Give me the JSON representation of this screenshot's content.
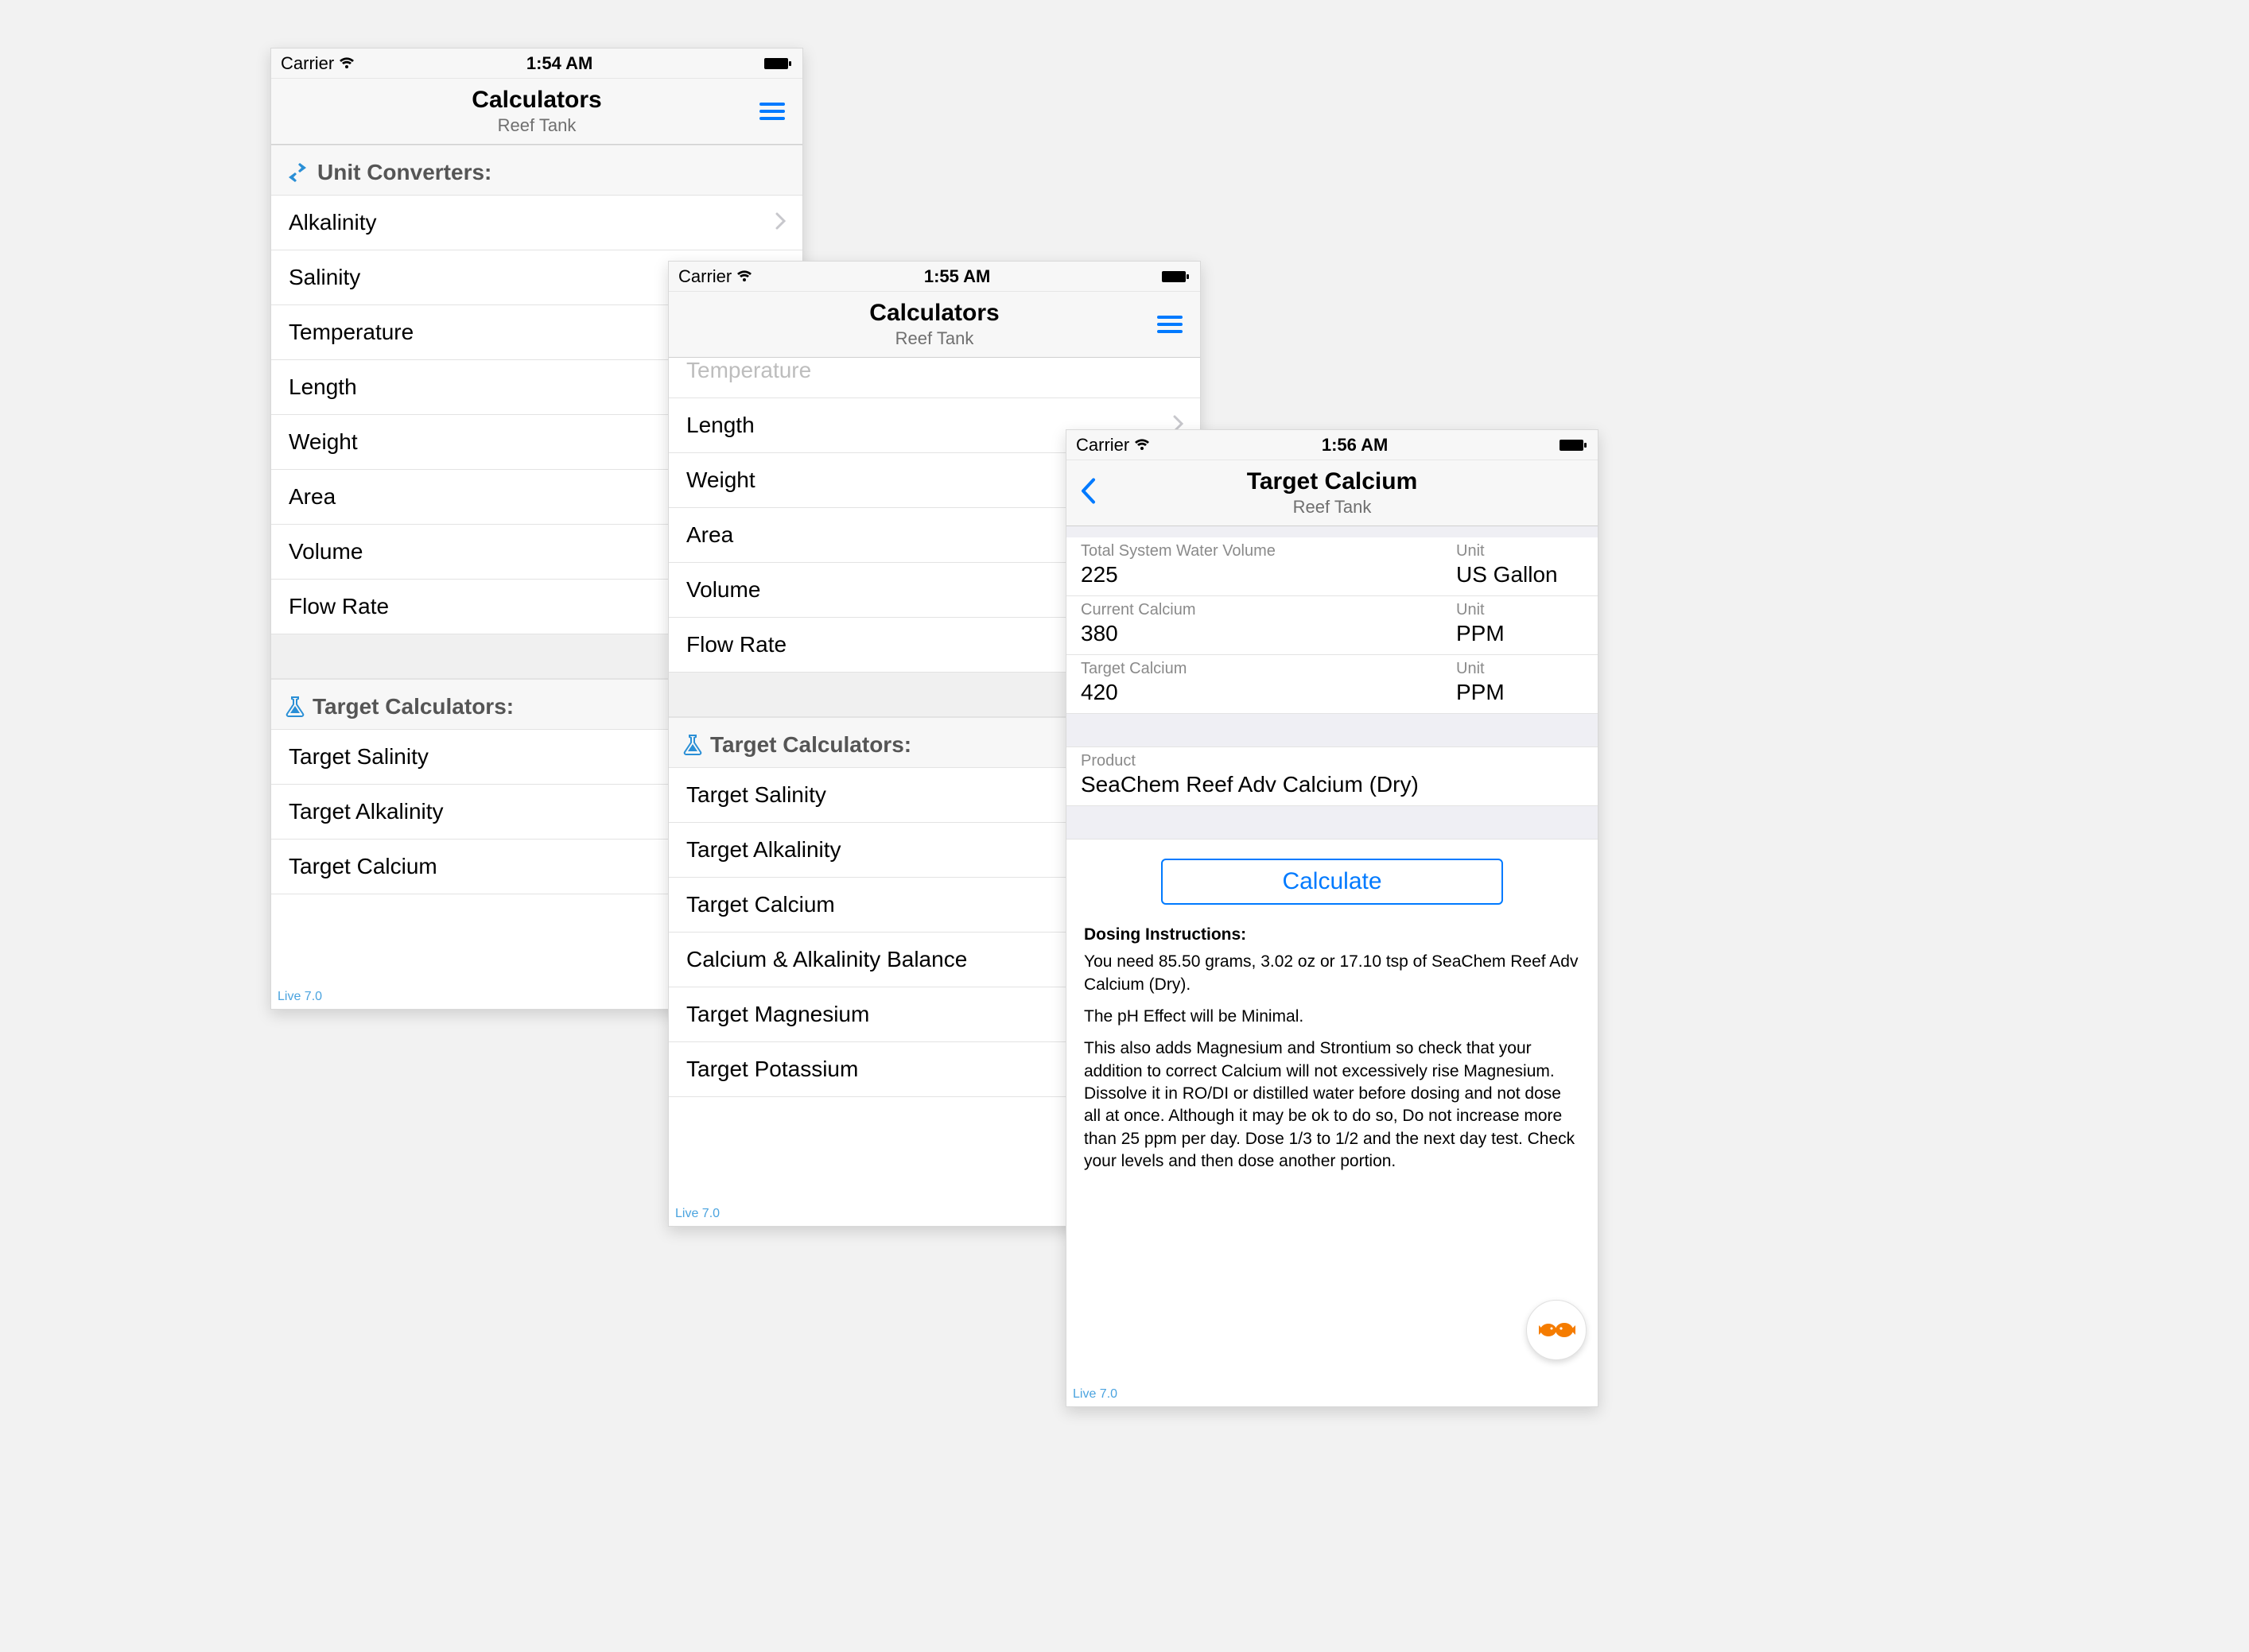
{
  "status": {
    "carrier": "Carrier",
    "time1": "1:54 AM",
    "time2": "1:55 AM",
    "time3": "1:56 AM"
  },
  "nav": {
    "calc_title": "Calculators",
    "calc_subtitle": "Reef Tank",
    "detail_title": "Target Calcium",
    "detail_subtitle": "Reef Tank"
  },
  "sections": {
    "unit_converters": "Unit Converters:",
    "target_calcs": "Target Calculators:"
  },
  "unit_items": {
    "alkalinity": "Alkalinity",
    "salinity": "Salinity",
    "temperature": "Temperature",
    "length": "Length",
    "weight": "Weight",
    "area": "Area",
    "volume": "Volume",
    "flow_rate": "Flow Rate"
  },
  "target_items": {
    "salinity": "Target Salinity",
    "alkalinity": "Target Alkalinity",
    "calcium": "Target Calcium",
    "ca_alk_balance": "Calcium & Alkalinity Balance",
    "magnesium": "Target Magnesium",
    "potassium": "Target Potassium"
  },
  "peek": {
    "temperature_ghost": "Temperature"
  },
  "form": {
    "total_volume_label": "Total System Water Volume",
    "total_volume_value": "225",
    "unit_label": "Unit",
    "volume_unit_value": "US Gallon",
    "current_label": "Current Calcium",
    "current_value": "380",
    "current_unit": "PPM",
    "target_label": "Target Calcium",
    "target_value": "420",
    "target_unit": "PPM",
    "product_label": "Product",
    "product_value": "SeaChem Reef Adv Calcium (Dry)"
  },
  "buttons": {
    "calculate": "Calculate"
  },
  "instructions": {
    "title": "Dosing Instructions:",
    "p1": "You need 85.50 grams, 3.02 oz or 17.10 tsp of SeaChem Reef Adv Calcium (Dry).",
    "p2": "The pH Effect will be Minimal.",
    "p3": "This also adds Magnesium and Strontium so check that your addition to correct Calcium will not excessively rise Magnesium. Dissolve it in RO/DI or distilled water before dosing and not dose all at once.  Although it may be ok to do so, Do not increase more than 25 ppm per day.  Dose 1/3 to 1/2 and the next day test.  Check your levels and then dose another portion."
  },
  "footer": {
    "live": "Live 7.0"
  }
}
